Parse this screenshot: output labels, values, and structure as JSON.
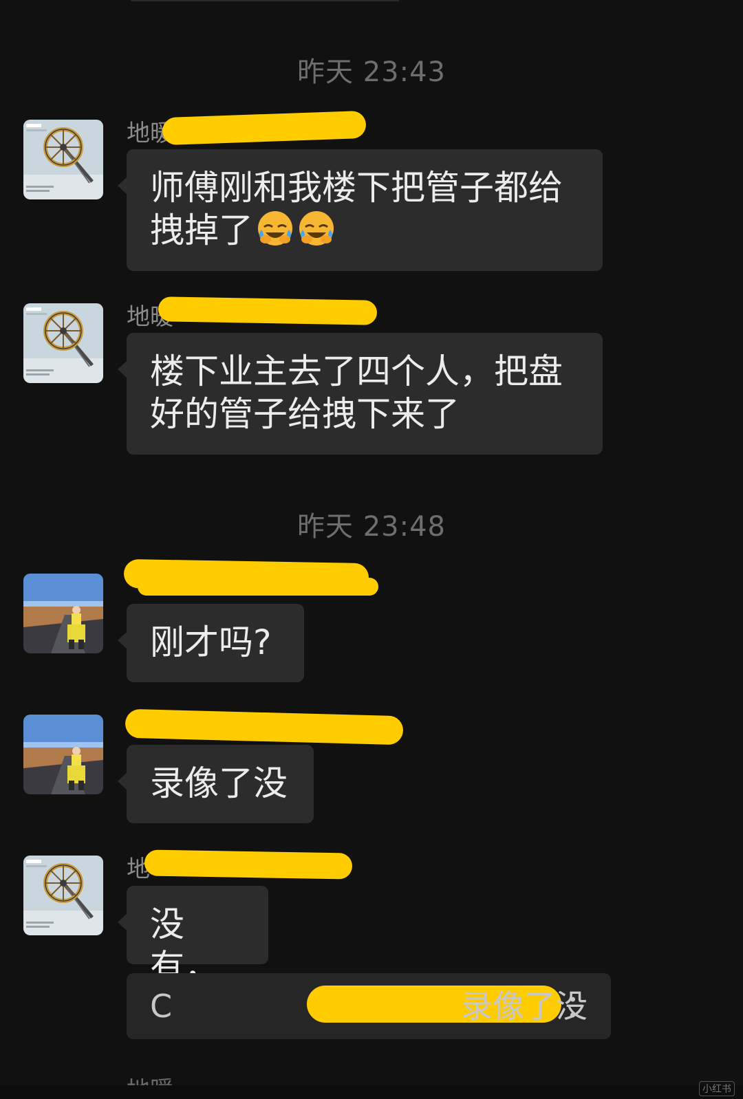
{
  "chat": {
    "timestamps": [
      "昨天 23:43",
      "昨天 23:48"
    ],
    "messages": [
      {
        "sender": "地暖",
        "avatar": "ferris-wheel-avatar",
        "text_lines": [
          "师傅刚和我楼下把管子都给",
          "拽掉了"
        ],
        "emojis": [
          "crying-laughing-emoji",
          "crying-laughing-emoji"
        ]
      },
      {
        "sender": "地暖",
        "avatar": "ferris-wheel-avatar",
        "text_lines": [
          "楼下业主去了四个人，把盘",
          "好的管子给拽下来了"
        ]
      },
      {
        "sender": "",
        "avatar": "road-photo-avatar",
        "text_lines": [
          "刚才吗?"
        ]
      },
      {
        "sender": "",
        "avatar": "road-photo-avatar",
        "text_lines": [
          "录像了没"
        ]
      },
      {
        "sender": "地",
        "avatar": "ferris-wheel-avatar",
        "text_lines": [
          "没有，"
        ],
        "quote": {
          "prefix": "C",
          "separator": "：",
          "text": "录像了没"
        }
      }
    ],
    "partial_sender": "地暖",
    "watermark": "小红书"
  },
  "colors": {
    "background": "#111111",
    "bubble": "#2c2c2c",
    "redaction": "#ffcc00",
    "timestamp": "#6e6e6e"
  }
}
